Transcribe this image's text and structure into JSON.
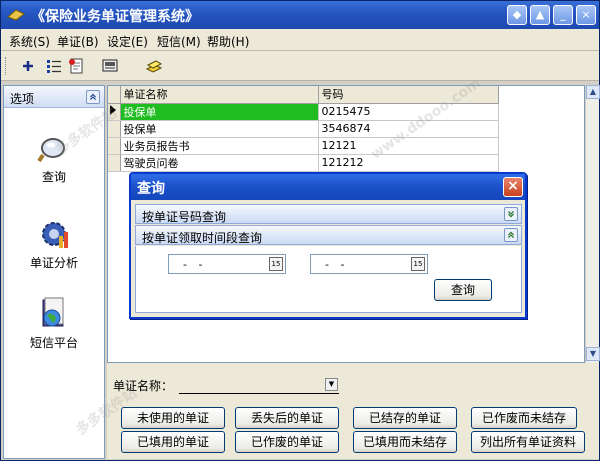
{
  "window": {
    "title": "《保险业务单证管理系统》",
    "controls": {
      "restore": "◆",
      "up": "▲",
      "minimize": "_",
      "close": "×"
    }
  },
  "menu": [
    "系统(S)",
    "单证(B)",
    "设定(E)",
    "短信(M)",
    "帮助(H)"
  ],
  "toolbar": {
    "icons": [
      "add-icon",
      "list-icon",
      "document-icon",
      "monitor-icon",
      "stack-icon"
    ]
  },
  "left_panel": {
    "header": "选项",
    "items": [
      {
        "label": "查询",
        "icon": "magnifier-icon"
      },
      {
        "label": "单证分析",
        "icon": "gear-chart-icon"
      },
      {
        "label": "短信平台",
        "icon": "globe-folder-icon"
      }
    ]
  },
  "grid": {
    "columns": [
      "单证名称",
      "号码"
    ],
    "rows": [
      {
        "name": "投保单",
        "number": "0215475",
        "selected": true
      },
      {
        "name": "投保单",
        "number": "3546874"
      },
      {
        "name": "业务员报告书",
        "number": "12121"
      },
      {
        "name": "驾驶员问卷",
        "number": "121212"
      }
    ]
  },
  "dialog": {
    "title": "查询",
    "close": "×",
    "sections": [
      {
        "label": "按单证号码查询",
        "chevron": "»"
      },
      {
        "label": "按单证领取时间段查询",
        "chevron": "«"
      }
    ],
    "date_from": "- -",
    "date_to": "- -",
    "calendar_label": "15",
    "query_button": "查询"
  },
  "bottom": {
    "doc_name_label": "单证名称：",
    "doc_name_value": "",
    "buttons": [
      "未使用的单证",
      "丢失后的单证",
      "已结存的单证",
      "已作废而未结存",
      "已填用的单证",
      "已作废的单证",
      "已填用而未结存",
      "列出所有单证资料"
    ]
  },
  "watermark": [
    "多多软件站",
    "www.ddooo.com"
  ]
}
